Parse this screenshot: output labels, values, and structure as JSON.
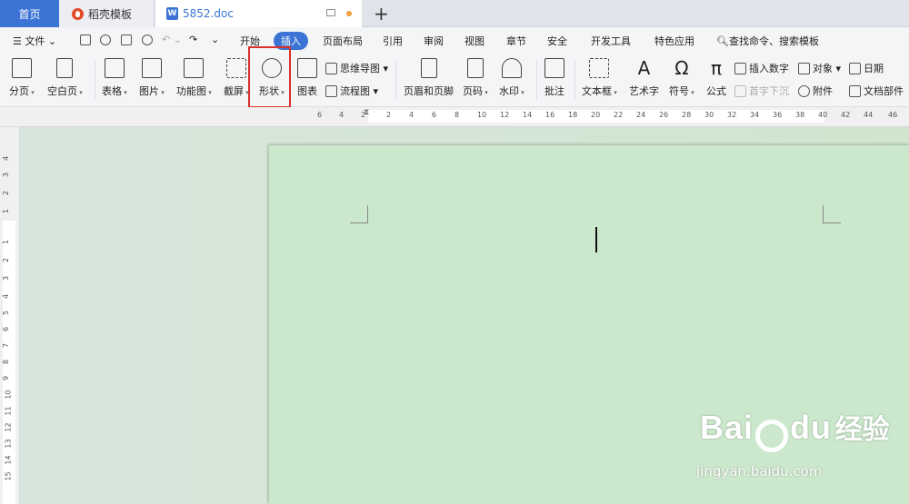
{
  "tabs": {
    "home": "首页",
    "template": "稻壳模板",
    "doc": "5852.doc",
    "new_tab": "+"
  },
  "menubar": {
    "file": "文件",
    "items": [
      "开始",
      "插入",
      "页面布局",
      "引用",
      "审阅",
      "视图",
      "章节",
      "安全",
      "开发工具",
      "特色应用"
    ],
    "active": "插入",
    "search": "查找命令、搜索模板"
  },
  "ribbon": {
    "page_break": "分页",
    "blank_page": "空白页",
    "table": "表格",
    "picture": "图片",
    "function_chart": "功能图",
    "screenshot": "截屏",
    "shape": "形状",
    "chart": "图表",
    "mind_map": "思维导图",
    "flowchart": "流程图",
    "header_footer": "页眉和页脚",
    "page_number": "页码",
    "watermark": "水印",
    "comment": "批注",
    "textbox": "文本框",
    "wordart": "艺术字",
    "symbol": "符号",
    "formula": "公式",
    "insert_number": "插入数字",
    "drop_cap": "首字下沉",
    "object": "对象",
    "attachment": "附件",
    "date": "日期",
    "doc_parts": "文档部件"
  },
  "ruler": {
    "h": [
      "6",
      "4",
      "2",
      "2",
      "4",
      "6",
      "8",
      "10",
      "12",
      "14",
      "16",
      "18",
      "20",
      "22",
      "24",
      "26",
      "28",
      "30",
      "32",
      "34",
      "36",
      "38",
      "40",
      "42",
      "44",
      "46"
    ],
    "v": [
      "4",
      "3",
      "2",
      "1",
      "1",
      "2",
      "3",
      "4",
      "5",
      "6",
      "7",
      "8",
      "9",
      "10",
      "11",
      "12",
      "13",
      "14",
      "15"
    ]
  },
  "watermark": {
    "brand": "Bai",
    "brand2": "du",
    "cn": "经验",
    "url": "jingyan.baidu.com"
  },
  "colors": {
    "accent": "#3b74d4",
    "page": "#cce8cc",
    "highlight": "#d9302a"
  }
}
